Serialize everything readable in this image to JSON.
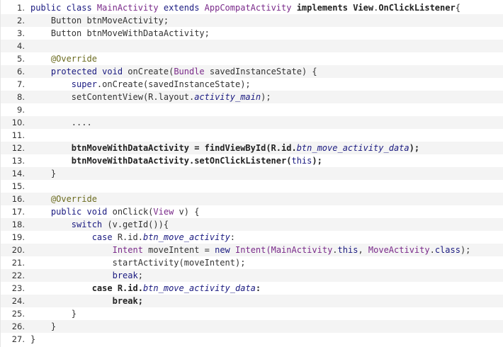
{
  "code": {
    "lines": [
      {
        "n": "1.",
        "t": [
          {
            "s": "public class ",
            "c": "kw"
          },
          {
            "s": "MainActivity",
            "c": "cls"
          },
          {
            "s": " extends ",
            "c": "kw"
          },
          {
            "s": "AppCompatActivity",
            "c": "cls"
          },
          {
            "s": " implements ",
            "c": "bold"
          },
          {
            "s": "View",
            "c": "bold"
          },
          {
            "s": ".",
            "c": "punct"
          },
          {
            "s": "OnClickListener",
            "c": "bold"
          },
          {
            "s": "{",
            "c": "punct"
          }
        ]
      },
      {
        "n": "2.",
        "t": [
          {
            "s": "    Button btnMoveActivity;",
            "c": "punct"
          }
        ]
      },
      {
        "n": "3.",
        "t": [
          {
            "s": "    Button btnMoveWithDataActivity;",
            "c": "punct"
          }
        ]
      },
      {
        "n": "4.",
        "t": [
          {
            "s": "",
            "c": "punct"
          }
        ]
      },
      {
        "n": "5.",
        "t": [
          {
            "s": "    @Override",
            "c": "ann"
          }
        ]
      },
      {
        "n": "6.",
        "t": [
          {
            "s": "    protected void ",
            "c": "kw"
          },
          {
            "s": "onCreate(",
            "c": "punct"
          },
          {
            "s": "Bundle",
            "c": "cls"
          },
          {
            "s": " savedInstanceState) {",
            "c": "punct"
          }
        ]
      },
      {
        "n": "7.",
        "t": [
          {
            "s": "        ",
            "c": "punct"
          },
          {
            "s": "super",
            "c": "kw"
          },
          {
            "s": ".onCreate(savedInstanceState);",
            "c": "punct"
          }
        ]
      },
      {
        "n": "8.",
        "t": [
          {
            "s": "        setContentView(R.layout.",
            "c": "punct"
          },
          {
            "s": "activity_main",
            "c": "ital"
          },
          {
            "s": ");",
            "c": "punct"
          }
        ]
      },
      {
        "n": "9.",
        "t": [
          {
            "s": "",
            "c": "punct"
          }
        ]
      },
      {
        "n": "10.",
        "t": [
          {
            "s": "        ....",
            "c": "punct"
          }
        ]
      },
      {
        "n": "11.",
        "t": [
          {
            "s": "",
            "c": "punct"
          }
        ]
      },
      {
        "n": "12.",
        "t": [
          {
            "s": "        btnMoveWithDataActivity = findViewById(R.id.",
            "c": "bold"
          },
          {
            "s": "btn_move_activity_data",
            "c": "ital"
          },
          {
            "s": ");",
            "c": "bold"
          }
        ]
      },
      {
        "n": "13.",
        "t": [
          {
            "s": "        btnMoveWithDataActivity.setOnClickListener(",
            "c": "bold"
          },
          {
            "s": "this",
            "c": "kw"
          },
          {
            "s": ");",
            "c": "bold"
          }
        ]
      },
      {
        "n": "14.",
        "t": [
          {
            "s": "    }",
            "c": "punct"
          }
        ]
      },
      {
        "n": "15.",
        "t": [
          {
            "s": "",
            "c": "punct"
          }
        ]
      },
      {
        "n": "16.",
        "t": [
          {
            "s": "    @Override",
            "c": "ann"
          }
        ]
      },
      {
        "n": "17.",
        "t": [
          {
            "s": "    public void ",
            "c": "kw"
          },
          {
            "s": "onClick(",
            "c": "punct"
          },
          {
            "s": "View",
            "c": "cls"
          },
          {
            "s": " v) {",
            "c": "punct"
          }
        ]
      },
      {
        "n": "18.",
        "t": [
          {
            "s": "        ",
            "c": "punct"
          },
          {
            "s": "switch",
            "c": "kw"
          },
          {
            "s": " (v.getId()){",
            "c": "punct"
          }
        ]
      },
      {
        "n": "19.",
        "t": [
          {
            "s": "            ",
            "c": "punct"
          },
          {
            "s": "case",
            "c": "kw"
          },
          {
            "s": " R.id.",
            "c": "punct"
          },
          {
            "s": "btn_move_activity",
            "c": "ital"
          },
          {
            "s": ":",
            "c": "punct"
          }
        ]
      },
      {
        "n": "20.",
        "t": [
          {
            "s": "                ",
            "c": "punct"
          },
          {
            "s": "Intent",
            "c": "cls"
          },
          {
            "s": " moveIntent = ",
            "c": "punct"
          },
          {
            "s": "new ",
            "c": "kw"
          },
          {
            "s": "Intent(",
            "c": "cls"
          },
          {
            "s": "MainActivity",
            "c": "cls"
          },
          {
            "s": ".",
            "c": "punct"
          },
          {
            "s": "this",
            "c": "kw"
          },
          {
            "s": ", ",
            "c": "punct"
          },
          {
            "s": "MoveActivity",
            "c": "cls"
          },
          {
            "s": ".",
            "c": "punct"
          },
          {
            "s": "class",
            "c": "kw"
          },
          {
            "s": ");",
            "c": "punct"
          }
        ]
      },
      {
        "n": "21.",
        "t": [
          {
            "s": "                startActivity(moveIntent);",
            "c": "punct"
          }
        ]
      },
      {
        "n": "22.",
        "t": [
          {
            "s": "                ",
            "c": "punct"
          },
          {
            "s": "break",
            "c": "kw"
          },
          {
            "s": ";",
            "c": "punct"
          }
        ]
      },
      {
        "n": "23.",
        "t": [
          {
            "s": "            ",
            "c": "punct"
          },
          {
            "s": "case R.id.",
            "c": "bold"
          },
          {
            "s": "btn_move_activity_data",
            "c": "ital"
          },
          {
            "s": ":",
            "c": "bold"
          }
        ]
      },
      {
        "n": "24.",
        "t": [
          {
            "s": "                ",
            "c": "punct"
          },
          {
            "s": "break",
            "c": "bold"
          },
          {
            "s": ";",
            "c": "bold"
          }
        ]
      },
      {
        "n": "25.",
        "t": [
          {
            "s": "        }",
            "c": "punct"
          }
        ]
      },
      {
        "n": "26.",
        "t": [
          {
            "s": "    }",
            "c": "punct"
          }
        ]
      },
      {
        "n": "27.",
        "t": [
          {
            "s": "}",
            "c": "punct"
          }
        ]
      }
    ]
  }
}
